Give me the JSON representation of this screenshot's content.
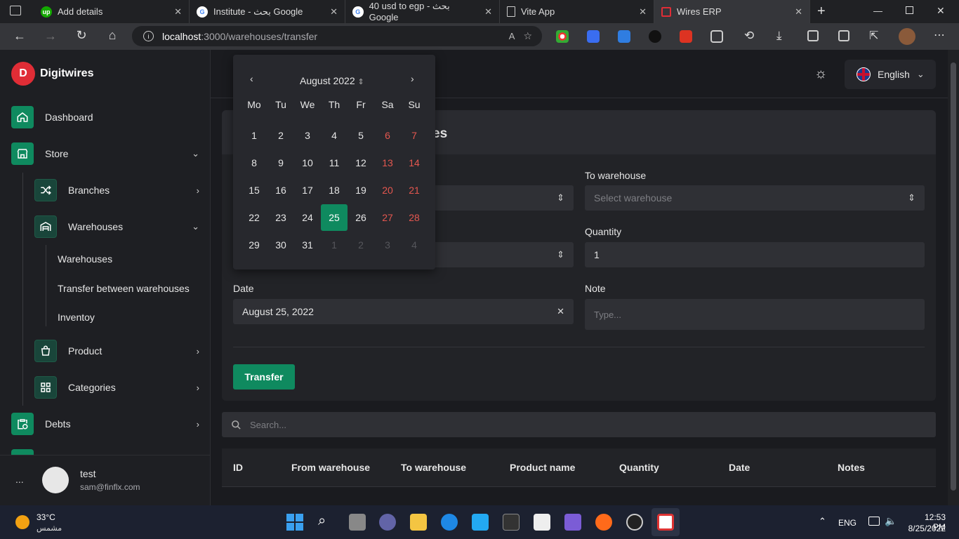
{
  "browser": {
    "tabs": [
      {
        "title": "Add details",
        "icon": "upwork-icon"
      },
      {
        "title": "Institute - بحث Google",
        "icon": "google-icon"
      },
      {
        "title": "40 usd to egp - بحث Google",
        "icon": "google-icon"
      },
      {
        "title": "Vite App",
        "icon": "page-icon"
      },
      {
        "title": "Wires ERP",
        "icon": "wires-icon"
      }
    ],
    "url_host": "localhost",
    "url_path": ":3000/warehouses/transfer"
  },
  "sidebar": {
    "brand": "Digitwires",
    "items": {
      "dashboard": "Dashboard",
      "store": "Store",
      "branches": "Branches",
      "warehouses": "Warehouses",
      "sub_warehouses": "Warehouses",
      "sub_transfer": "Transfer between warehouses",
      "sub_inventory": "Inventoy",
      "product": "Product",
      "categories": "Categories",
      "debts": "Debts"
    },
    "user": {
      "name": "test",
      "email": "sam@finflx.com",
      "more": "..."
    }
  },
  "header": {
    "language": "English"
  },
  "form": {
    "title_fragment": "es",
    "to_warehouse_label": "To warehouse",
    "to_warehouse_placeholder": "Select warehouse",
    "quantity_label": "Quantity",
    "quantity_value": "1",
    "date_label": "Date",
    "date_value": "August 25, 2022",
    "note_label": "Note",
    "note_placeholder": "Type...",
    "submit": "Transfer"
  },
  "datepicker": {
    "month": "August 2022",
    "weekdays": [
      "Mo",
      "Tu",
      "We",
      "Th",
      "Fr",
      "Sa",
      "Su"
    ],
    "weeks": [
      [
        "1",
        "2",
        "3",
        "4",
        "5",
        "6",
        "7"
      ],
      [
        "8",
        "9",
        "10",
        "11",
        "12",
        "13",
        "14"
      ],
      [
        "15",
        "16",
        "17",
        "18",
        "19",
        "20",
        "21"
      ],
      [
        "22",
        "23",
        "24",
        "25",
        "26",
        "27",
        "28"
      ],
      [
        "29",
        "30",
        "31",
        "1",
        "2",
        "3",
        "4"
      ]
    ],
    "selected": "25"
  },
  "search": {
    "placeholder": "Search..."
  },
  "table": {
    "columns": [
      "ID",
      "From warehouse",
      "To warehouse",
      "Product name",
      "Quantity",
      "Date",
      "Notes"
    ]
  },
  "taskbar": {
    "weather_temp": "33°C",
    "weather_desc": "مشمس",
    "lang": "ENG",
    "time": "12:53 PM",
    "date": "8/25/2022"
  },
  "colors": {
    "accent": "#0f8a5f",
    "brand": "#e02d36",
    "weekend": "#e4574f"
  }
}
